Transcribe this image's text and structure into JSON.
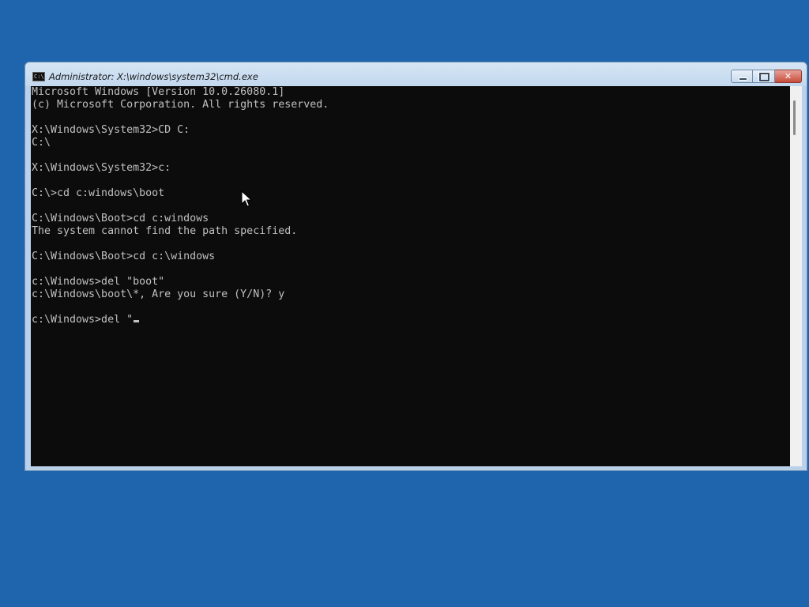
{
  "window": {
    "title": "Administrator: X:\\windows\\system32\\cmd.exe",
    "icon": "cmd-icon"
  },
  "caption_buttons": {
    "minimize": "minimize-icon",
    "maximize": "maximize-icon",
    "close": "close-icon"
  },
  "console": {
    "lines": [
      "Microsoft Windows [Version 10.0.26080.1]",
      "(c) Microsoft Corporation. All rights reserved.",
      "",
      "X:\\Windows\\System32>CD C:",
      "C:\\",
      "",
      "X:\\Windows\\System32>c:",
      "",
      "C:\\>cd c:windows\\boot",
      "",
      "C:\\Windows\\Boot>cd c:windows",
      "The system cannot find the path specified.",
      "",
      "C:\\Windows\\Boot>cd c:\\windows",
      "",
      "c:\\Windows>del \"boot\"",
      "c:\\Windows\\boot\\*, Are you sure (Y/N)? y",
      "",
      "c:\\Windows>del \""
    ],
    "text_color": "#c0c0c0",
    "background_color": "#0c0c0c"
  },
  "desktop": {
    "background_color": "#1f65ae"
  }
}
